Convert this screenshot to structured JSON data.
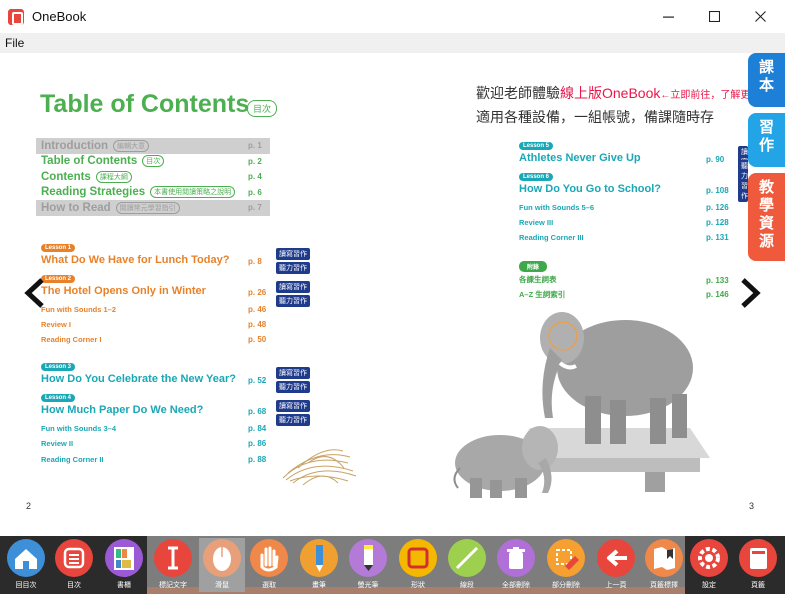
{
  "window": {
    "title": "OneBook",
    "minimize": "—",
    "maximize": "☐",
    "close": "✕"
  },
  "menu": {
    "file": "File"
  },
  "left_page": {
    "title": "Table of Contents",
    "title_badge": "目次",
    "page_number": "2",
    "intro_rows": [
      {
        "label": "Introduction",
        "tag": "編輯大意",
        "page": "p. 1",
        "greyed": true
      },
      {
        "label": "Table of Contents",
        "tag": "目次",
        "page": "p. 2",
        "greyed": false
      },
      {
        "label": "Contents",
        "tag": "課程大綱",
        "page": "p. 4",
        "greyed": false
      },
      {
        "label": "Reading Strategies",
        "tag": "本書使用閱讀策略之說明",
        "page": "p. 6",
        "greyed": false
      },
      {
        "label": "How to Read",
        "tag": "閱讀常元學習指引",
        "page": "p. 7",
        "greyed": true
      }
    ],
    "lesson1": {
      "pill": "Lesson 1",
      "title": "What Do We Have for Lunch Today?",
      "page": "p. 8"
    },
    "lesson2": {
      "pill": "Lesson 2",
      "title": "The Hotel Opens Only in Winter",
      "page": "p. 26"
    },
    "fun1": {
      "label": "Fun with Sounds 1–2",
      "page": "p. 46"
    },
    "review1": {
      "label": "Review I",
      "page": "p. 48"
    },
    "rc1": {
      "label": "Reading Corner I",
      "page": "p. 50"
    },
    "lesson3": {
      "pill": "Lesson 3",
      "title": "How Do You Celebrate the New Year?",
      "page": "p. 52"
    },
    "lesson4": {
      "pill": "Lesson 4",
      "title": "How Much Paper Do We Need?",
      "page": "p. 68"
    },
    "fun2": {
      "label": "Fun with Sounds 3–4",
      "page": "p. 84"
    },
    "review2": {
      "label": "Review II",
      "page": "p. 86"
    },
    "rc2": {
      "label": "Reading Corner II",
      "page": "p. 88"
    },
    "tag_workbook": "讀寫習作",
    "tag_listening": "聽力習作"
  },
  "right_page": {
    "promo_line1_a": "歡迎老師體驗",
    "promo_line1_b": "線上版OneBook",
    "promo_line1_c": "←立即前往，了解更",
    "promo_line2": "適用各種設備，一組帳號，備課隨時存",
    "page_number": "3",
    "lesson5": {
      "pill": "Lesson 5",
      "title": "Athletes Never Give Up",
      "page": "p. 90"
    },
    "lesson6": {
      "pill": "Lesson 6",
      "title": "How Do You Go to School?",
      "page": "p. 108"
    },
    "fun3": {
      "label": "Fun with Sounds 5–6",
      "page": "p. 126"
    },
    "review3": {
      "label": "Review III",
      "page": "p. 128"
    },
    "rc3": {
      "label": "Reading Corner III",
      "page": "p. 131"
    },
    "appendix_pill": "附錄",
    "appendix1": {
      "label": "各課生詞表",
      "page": "p. 133"
    },
    "appendix2": {
      "label": "A–Z 生詞索引",
      "page": "p. 146"
    }
  },
  "side_tabs": [
    {
      "label": "課本",
      "color": "#1e7fd6"
    },
    {
      "label": "習作",
      "color": "#22a4e6"
    },
    {
      "label": "教學資源",
      "color": "#f05a3c"
    }
  ],
  "toolbar": {
    "items": [
      {
        "label": "回目次",
        "icon": "home-icon",
        "color": "#3d8fd8"
      },
      {
        "label": "目次",
        "icon": "list-icon",
        "color": "#e8453c"
      },
      {
        "label": "書櫃",
        "icon": "bookshelf-icon",
        "color": "#9b59d6"
      },
      {
        "label": "標記文字",
        "icon": "text-cursor-icon",
        "color": "#e8453c"
      },
      {
        "label": "滑鼠",
        "icon": "mouse-icon",
        "color": "#e8a07a"
      },
      {
        "label": "選取",
        "icon": "hand-icon",
        "color": "#f0884a"
      },
      {
        "label": "畫筆",
        "icon": "pen-icon",
        "color": "#f0a030"
      },
      {
        "label": "螢光筆",
        "icon": "highlighter-icon",
        "color": "#b47ad8"
      },
      {
        "label": "形狀",
        "icon": "shape-icon",
        "color": "#f5b800"
      },
      {
        "label": "線段",
        "icon": "line-icon",
        "color": "#9ed050"
      },
      {
        "label": "全部刪除",
        "icon": "trash-icon",
        "color": "#b070d8"
      },
      {
        "label": "部分刪除",
        "icon": "eraser-icon",
        "color": "#f5a030"
      },
      {
        "label": "上一頁",
        "icon": "back-arrow-icon",
        "color": "#e8453c"
      },
      {
        "label": "頁籤標擇",
        "icon": "bookmark-icon",
        "color": "#f0884a"
      },
      {
        "label": "設定",
        "icon": "gear-icon",
        "color": "#e8453c"
      },
      {
        "label": "頁籤",
        "icon": "book-icon",
        "color": "#e8453c"
      }
    ]
  }
}
